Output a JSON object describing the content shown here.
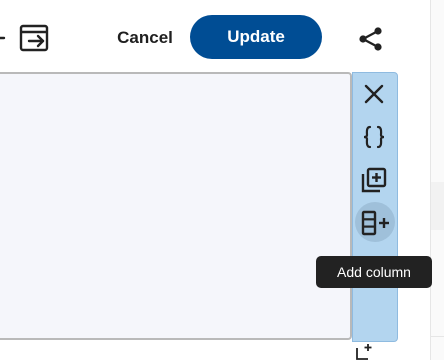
{
  "header": {
    "icons": [
      "arrow-left-icon",
      "exit-icon",
      "share-icon"
    ],
    "cancel_label": "Cancel",
    "update_label": "Update"
  },
  "editor_toolbar": {
    "icons": [
      "close-icon",
      "braces-icon",
      "add-layer-icon",
      "add-column-icon"
    ],
    "tooltip": "Add column"
  },
  "footer": {
    "icons": [
      "add-box-icon"
    ]
  },
  "colors": {
    "accent": "#004d94",
    "toolbar_bg": "#b3d5ef",
    "editor_bg": "#f5f6fb",
    "tooltip_bg": "#222222"
  }
}
